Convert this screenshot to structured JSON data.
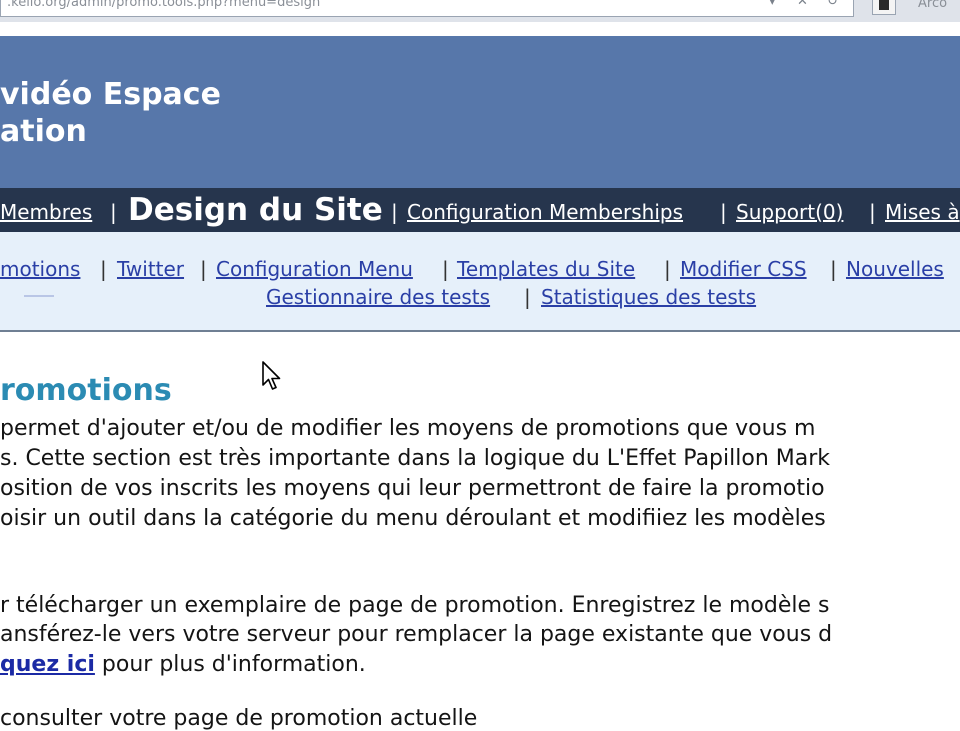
{
  "browser": {
    "url": ".kello.org/admin/promo.tools.php?menu=design",
    "address_tail": "Arco"
  },
  "header": {
    "title_line1": "vidéo Espace",
    "title_line2": "ation"
  },
  "main_nav": {
    "item_members": "Membres",
    "current": "Design du Site",
    "item_config_memberships": "Configuration Memberships",
    "item_support": "Support(0)",
    "item_mises": "Mises à",
    "separator": "|"
  },
  "sub_nav": {
    "row1": [
      "motions",
      "Twitter",
      "Configuration Menu",
      "Templates du Site",
      "Modifier CSS",
      "Nouvelles"
    ],
    "row2": [
      "Gestionnaire des tests",
      "Statistiques des tests"
    ],
    "separator": "|"
  },
  "content": {
    "title": "romotions",
    "p1_l1": " permet d'ajouter et/ou de modifier les moyens de promotions que vous m",
    "p1_l2": "s. Cette section est très importante dans la logique du L'Effet Papillon Mark",
    "p1_l3": "osition de vos inscrits les moyens qui leur permettront de faire la promotio",
    "p1_l4": "oisir un outil dans la catégorie du menu déroulant et modifiiez les modèles",
    "p2_l1": "r télécharger un exemplaire de page de promotion. Enregistrez le modèle s",
    "p2_l2": "ansférez-le vers votre serveur pour remplacer la page existante que vous d",
    "p2_link": "quez ici",
    "p2_l3_rest": " pour plus d'information.",
    "p3_l1": " consulter votre page de promotion actuelle"
  },
  "colors": {
    "header_bg": "#5777aa",
    "nav_bg": "#26354d",
    "subnav_bg": "#e6f0fa",
    "link": "#2a3fa6",
    "title": "#2b8bb3"
  }
}
